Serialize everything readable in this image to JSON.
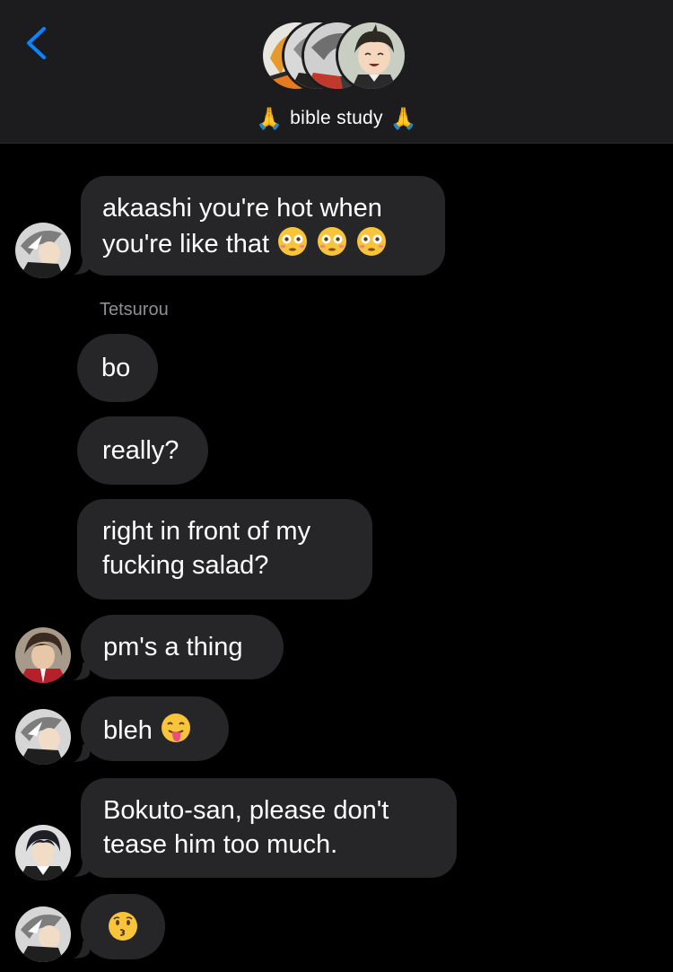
{
  "header": {
    "back_icon": "chevron-left-icon",
    "group_name": "bible study",
    "group_icon_left": "folded-hands-emoji",
    "group_icon_right": "folded-hands-emoji",
    "accent_color": "#0a84ff"
  },
  "messages": [
    {
      "sender_avatar": "bokuto-avatar",
      "text": "akaashi you're hot when\nyou're like that",
      "emoji": [
        "flushed-face",
        "flushed-face",
        "flushed-face"
      ]
    },
    {
      "sender_label": "Tetsurou"
    },
    {
      "text": "bo"
    },
    {
      "text": "really?"
    },
    {
      "text": "right in front of my\nfucking salad?"
    },
    {
      "sender_avatar": "kuroo-avatar",
      "text": "pm's a thing"
    },
    {
      "sender_avatar": "bokuto-avatar",
      "text": "bleh",
      "emoji": [
        "tongue-face"
      ]
    },
    {
      "sender_avatar": "akaashi-avatar",
      "text": "Bokuto-san, please don't\ntease him too much."
    },
    {
      "sender_avatar": "bokuto-avatar",
      "text": "",
      "emoji": [
        "kissing-face"
      ]
    }
  ],
  "colors": {
    "background": "#000000",
    "header_bg": "#1c1c1e",
    "bubble_bg": "#262628",
    "sender_label": "#8e8e93",
    "text": "#ffffff"
  }
}
